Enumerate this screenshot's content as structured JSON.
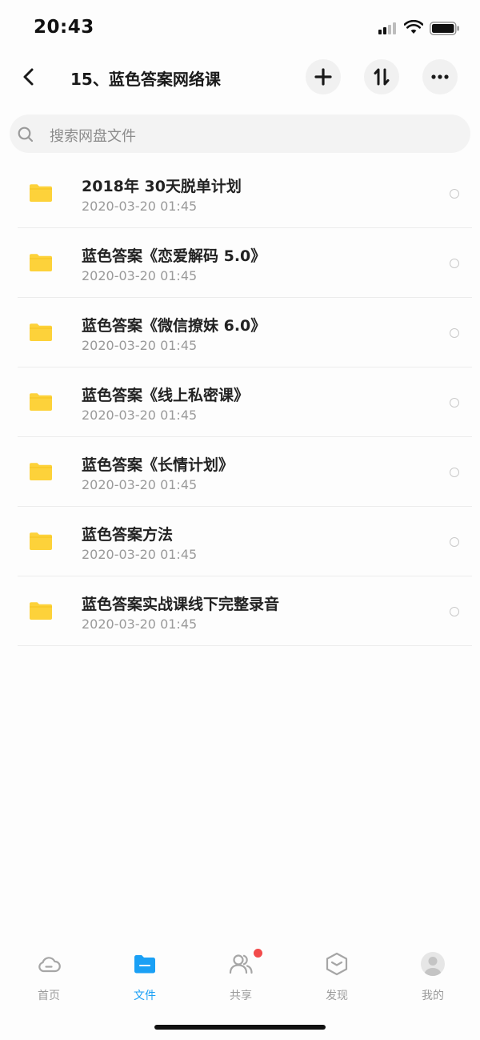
{
  "status_bar": {
    "time": "20:43"
  },
  "header": {
    "title": "15、蓝色答案网络课",
    "back_icon": "chevron-left-icon",
    "add_icon": "plus-icon",
    "sort_icon": "sort-arrows-icon",
    "more_icon": "more-dots-icon"
  },
  "search": {
    "placeholder": "搜索网盘文件"
  },
  "files": [
    {
      "name": "2018年 30天脱单计划",
      "date": "2020-03-20 01:45"
    },
    {
      "name": "蓝色答案《恋爱解码 5.0》",
      "date": "2020-03-20 01:45"
    },
    {
      "name": "蓝色答案《微信撩妹 6.0》",
      "date": "2020-03-20 01:45"
    },
    {
      "name": "蓝色答案《线上私密课》",
      "date": "2020-03-20 01:45"
    },
    {
      "name": "蓝色答案《长情计划》",
      "date": "2020-03-20 01:45"
    },
    {
      "name": "蓝色答案方法",
      "date": "2020-03-20 01:45"
    },
    {
      "name": "蓝色答案实战课线下完整录音",
      "date": "2020-03-20 01:45"
    }
  ],
  "tabs": [
    {
      "label": "首页",
      "icon": "cloud-icon",
      "active": false
    },
    {
      "label": "文件",
      "icon": "folder-icon",
      "active": true
    },
    {
      "label": "共享",
      "icon": "people-icon",
      "active": false,
      "badge": true
    },
    {
      "label": "发现",
      "icon": "hexagon-box-icon",
      "active": false
    },
    {
      "label": "我的",
      "icon": "avatar-icon",
      "active": false
    }
  ],
  "colors": {
    "accent": "#1aa0f5",
    "folder": "#fdd23a",
    "badge": "#f24b4b"
  }
}
